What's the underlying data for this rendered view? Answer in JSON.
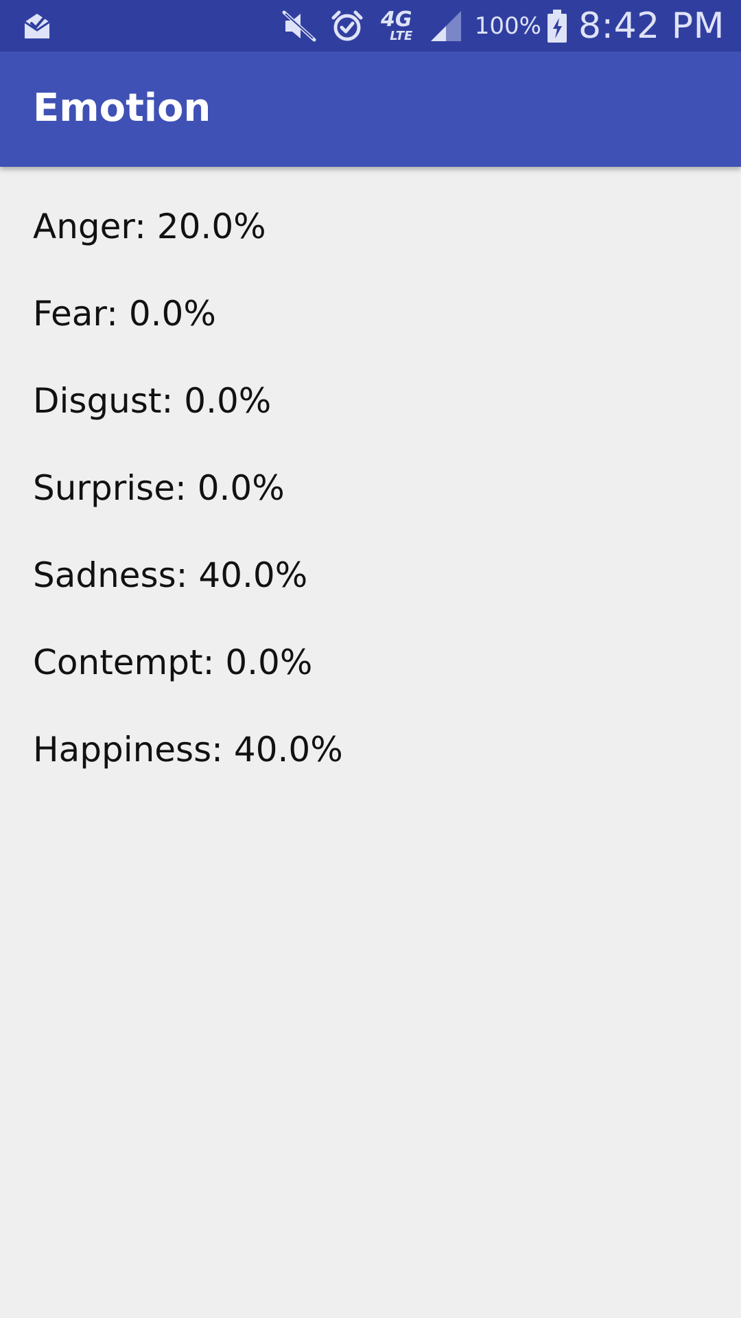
{
  "status_bar": {
    "icons": {
      "left": "mail-check-icon",
      "mute": "mute-icon",
      "alarm": "alarm-icon",
      "network": "4g-lte-icon",
      "signal": "signal-icon",
      "battery": "battery-charging-icon"
    },
    "network_label_top": "4G",
    "network_label_bottom": "LTE",
    "battery_percent": "100%",
    "time": "8:42 PM"
  },
  "app_bar": {
    "title": "Emotion",
    "color": "#3f51b5"
  },
  "emotions": [
    {
      "text": "Anger: 20.0%"
    },
    {
      "text": "Fear: 0.0%"
    },
    {
      "text": "Disgust: 0.0%"
    },
    {
      "text": "Surprise: 0.0%"
    },
    {
      "text": "Sadness: 40.0%"
    },
    {
      "text": "Contempt: 0.0%"
    },
    {
      "text": "Happiness: 40.0%"
    }
  ],
  "colors": {
    "status_bar": "#303f9f",
    "background": "#efefef",
    "text": "#111111"
  }
}
